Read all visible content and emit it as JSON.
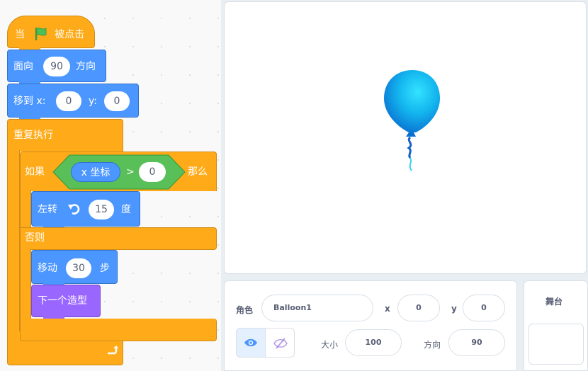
{
  "blocks": {
    "when_flag": {
      "prefix": "当",
      "suffix": "被点击"
    },
    "point_direction": {
      "label": "面向",
      "value": "90",
      "suffix": "方向"
    },
    "goto_xy": {
      "label": "移到 x:",
      "x": "0",
      "y_label": "y:",
      "y": "0"
    },
    "forever": {
      "label": "重复执行"
    },
    "if_else": {
      "if_label": "如果",
      "then_label": "那么",
      "else_label": "否则"
    },
    "condition": {
      "reporter": "x 坐标",
      "operator": ">",
      "value": "0"
    },
    "turn_left": {
      "label": "左转",
      "value": "15",
      "suffix": "度"
    },
    "move": {
      "label": "移动",
      "value": "30",
      "suffix": "步"
    },
    "next_costume": {
      "label": "下一个造型"
    }
  },
  "sprite_info": {
    "sprite_label": "角色",
    "sprite_name": "Balloon1",
    "x_label": "x",
    "x_value": "0",
    "y_label": "y",
    "y_value": "0",
    "size_label": "大小",
    "size_value": "100",
    "direction_label": "方向",
    "direction_value": "90"
  },
  "stage_pane": {
    "title": "舞台"
  },
  "colors": {
    "events": "#ffab19",
    "motion": "#4c97ff",
    "looks": "#9966ff",
    "operators": "#59c059",
    "balloon": "#1e9be0"
  }
}
